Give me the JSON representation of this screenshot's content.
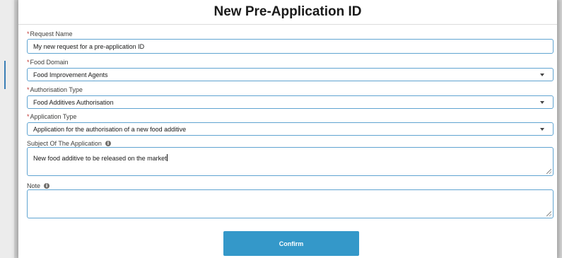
{
  "modal": {
    "title": "New Pre-Application ID",
    "confirm_label": "Confirm"
  },
  "fields": {
    "request_name": {
      "label": "Request Name",
      "required_marker": "*",
      "value": "My new request for a pre-application ID"
    },
    "food_domain": {
      "label": "Food Domain",
      "required_marker": "*",
      "value": "Food Improvement Agents"
    },
    "authorisation_type": {
      "label": "Authorisation Type",
      "required_marker": "*",
      "value": "Food Additives Authorisation"
    },
    "application_type": {
      "label": "Application Type",
      "required_marker": "*",
      "value": "Application for the authorisation of a new food additive"
    },
    "subject": {
      "label": "Subject Of The Application",
      "info_glyph": "i",
      "value": "New food additive to be released on the market"
    },
    "note": {
      "label": "Note",
      "info_glyph": "i",
      "value": ""
    }
  },
  "icons": {
    "caret": "chevron-down-icon",
    "info": "info-icon",
    "resize": "resize-handle-icon"
  },
  "colors": {
    "accent": "#3498c9",
    "field_border": "#60a4d1",
    "required": "#c23934"
  }
}
